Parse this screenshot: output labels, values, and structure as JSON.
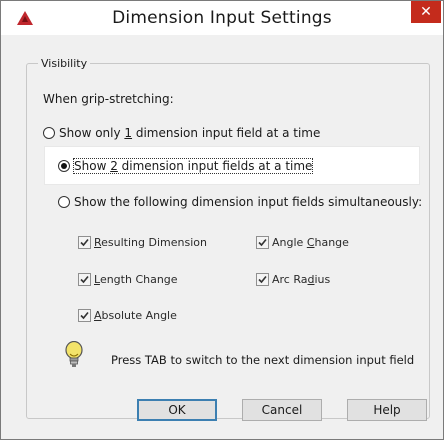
{
  "window": {
    "title": "Dimension Input Settings",
    "close_glyph": "✕",
    "app_icon": "autocad-logo-icon"
  },
  "group": {
    "label": "Visibility",
    "subtitle": "When grip-stretching:"
  },
  "radios": [
    {
      "pre": "Show only ",
      "accel": "1",
      "post": " dimension input field at a time",
      "checked": false
    },
    {
      "pre": "Show ",
      "accel": "2",
      "post": " dimension input fields at a time",
      "checked": true
    },
    {
      "pre": "Show the following dimension input fields simultaneously:",
      "accel": "",
      "post": "",
      "checked": false
    }
  ],
  "checkboxes": {
    "resulting": {
      "accel": "R",
      "rest": "esulting Dimension",
      "checked": true
    },
    "angle_change": {
      "pre": "Angle ",
      "accel": "C",
      "rest": "hange",
      "checked": true
    },
    "length_change": {
      "accel": "L",
      "rest": "ength Change",
      "checked": true
    },
    "arc_radius": {
      "pre": "Arc Ra",
      "accel": "d",
      "rest": "ius",
      "checked": true
    },
    "absolute_angle": {
      "accel": "A",
      "rest": "bsolute Angle",
      "checked": true
    }
  },
  "tip": {
    "icon": "lightbulb-icon",
    "text": "Press TAB to switch to the next dimension input field"
  },
  "buttons": {
    "ok": "OK",
    "cancel": "Cancel",
    "help": "Help"
  },
  "colors": {
    "close": "#c42b1c",
    "logo": "#c0272d",
    "default_button_border": "#3c7fb1"
  }
}
